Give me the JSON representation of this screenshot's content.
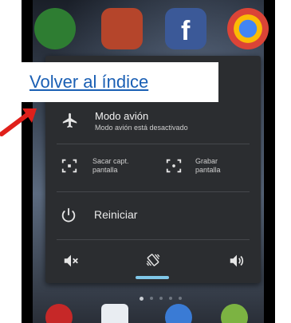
{
  "link": {
    "label": "Volver al índice"
  },
  "power_menu": {
    "airplane_mode": {
      "title": "Modo avión",
      "subtitle": "Modo avión está desactivado"
    },
    "screenshot": {
      "label_line1": "Sacar capt.",
      "label_line2": "pantalla"
    },
    "screen_record": {
      "label_line1": "Grabar",
      "label_line2": "pantalla"
    },
    "restart": {
      "label": "Reiniciar"
    },
    "sound_modes": {
      "selected": "vibrate"
    }
  },
  "home_screen": {
    "page_indicator": {
      "count": 5,
      "active_index": 0
    }
  },
  "colors": {
    "link": "#1a5fb4",
    "menu_bg": "#2b2d30",
    "accent": "#7fc7e8",
    "arrow": "#e0201b"
  }
}
